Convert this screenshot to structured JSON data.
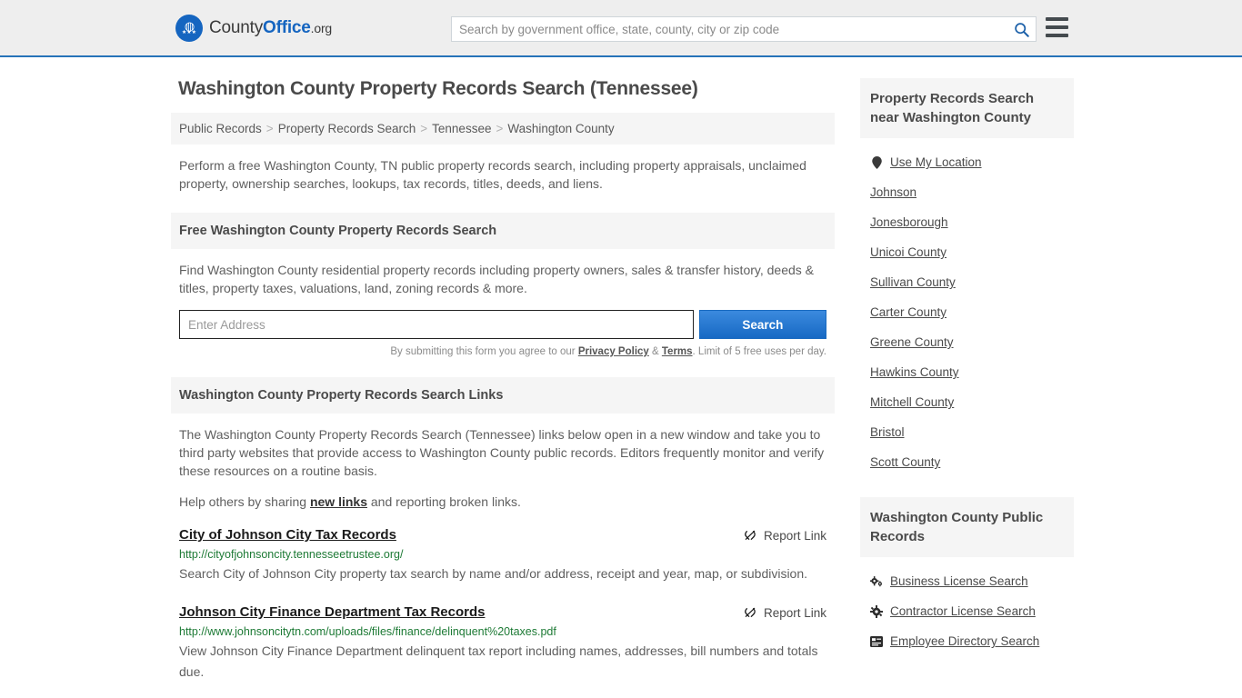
{
  "header": {
    "logo": {
      "icon": "eagle-shield-logo-icon",
      "text_part1": "County",
      "text_part2": "Office",
      "text_part3": ".org"
    },
    "search": {
      "placeholder": "Search by government office, state, county, city or zip code",
      "value": "",
      "icon": "search-icon"
    },
    "menu_icon": "hamburger-menu-icon",
    "accent_color": "#2673b8"
  },
  "main": {
    "page_title": "Washington County Property Records Search (Tennessee)",
    "breadcrumb": [
      "Public Records",
      "Property Records Search",
      "Tennessee",
      "Washington County"
    ],
    "breadcrumb_separator": ">",
    "intro": "Perform a free Washington County, TN public property records search, including property appraisals, unclaimed property, ownership searches, lookups, tax records, titles, deeds, and liens.",
    "free_search": {
      "heading": "Free Washington County Property Records Search",
      "description": "Find Washington County residential property records including property owners, sales & transfer history, deeds & titles, property taxes, valuations, land, zoning records & more.",
      "address_placeholder": "Enter Address",
      "address_value": "",
      "search_button": "Search",
      "disclaimer_prefix": "By submitting this form you agree to our ",
      "disclaimer_privacy": "Privacy Policy",
      "disclaimer_amp": " & ",
      "disclaimer_terms": "Terms",
      "disclaimer_suffix": ". Limit of 5 free uses per day."
    },
    "links_section": {
      "heading": "Washington County Property Records Search Links",
      "paragraph": "The Washington County Property Records Search (Tennessee) links below open in a new window and take you to third party websites that provide access to Washington County public records. Editors frequently monitor and verify these resources on a routine basis.",
      "help_prefix": "Help others by sharing ",
      "help_link": "new links",
      "help_suffix": " and reporting broken links.",
      "report_label": "Report Link",
      "report_icon": "broken-link-icon"
    },
    "results": [
      {
        "title": "City of Johnson City Tax Records",
        "url": "http://cityofjohnsoncity.tennesseetrustee.org/",
        "description": "Search City of Johnson City property tax search by name and/or address, receipt and year, map, or subdivision."
      },
      {
        "title": "Johnson City Finance Department Tax Records",
        "url": "http://www.johnsoncitytn.com/uploads/files/finance/delinquent%20taxes.pdf",
        "description": "View Johnson City Finance Department delinquent tax report including names, addresses, bill numbers and totals due."
      }
    ]
  },
  "sidebar": {
    "nearby": {
      "heading": "Property Records Search near Washington County",
      "items": [
        {
          "label": "Use My Location",
          "icon": "map-pin-icon"
        },
        {
          "label": "Johnson",
          "icon": ""
        },
        {
          "label": "Jonesborough",
          "icon": ""
        },
        {
          "label": "Unicoi County",
          "icon": ""
        },
        {
          "label": "Sullivan County",
          "icon": ""
        },
        {
          "label": "Carter County",
          "icon": ""
        },
        {
          "label": "Greene County",
          "icon": ""
        },
        {
          "label": "Hawkins County",
          "icon": ""
        },
        {
          "label": "Mitchell County",
          "icon": ""
        },
        {
          "label": "Bristol",
          "icon": ""
        },
        {
          "label": "Scott County",
          "icon": ""
        }
      ]
    },
    "public_records": {
      "heading": "Washington County Public Records",
      "items": [
        {
          "label": "Business License Search",
          "icon": "gears-icon"
        },
        {
          "label": "Contractor License Search",
          "icon": "gear-icon"
        },
        {
          "label": "Employee Directory Search",
          "icon": "list-icon"
        }
      ]
    }
  }
}
